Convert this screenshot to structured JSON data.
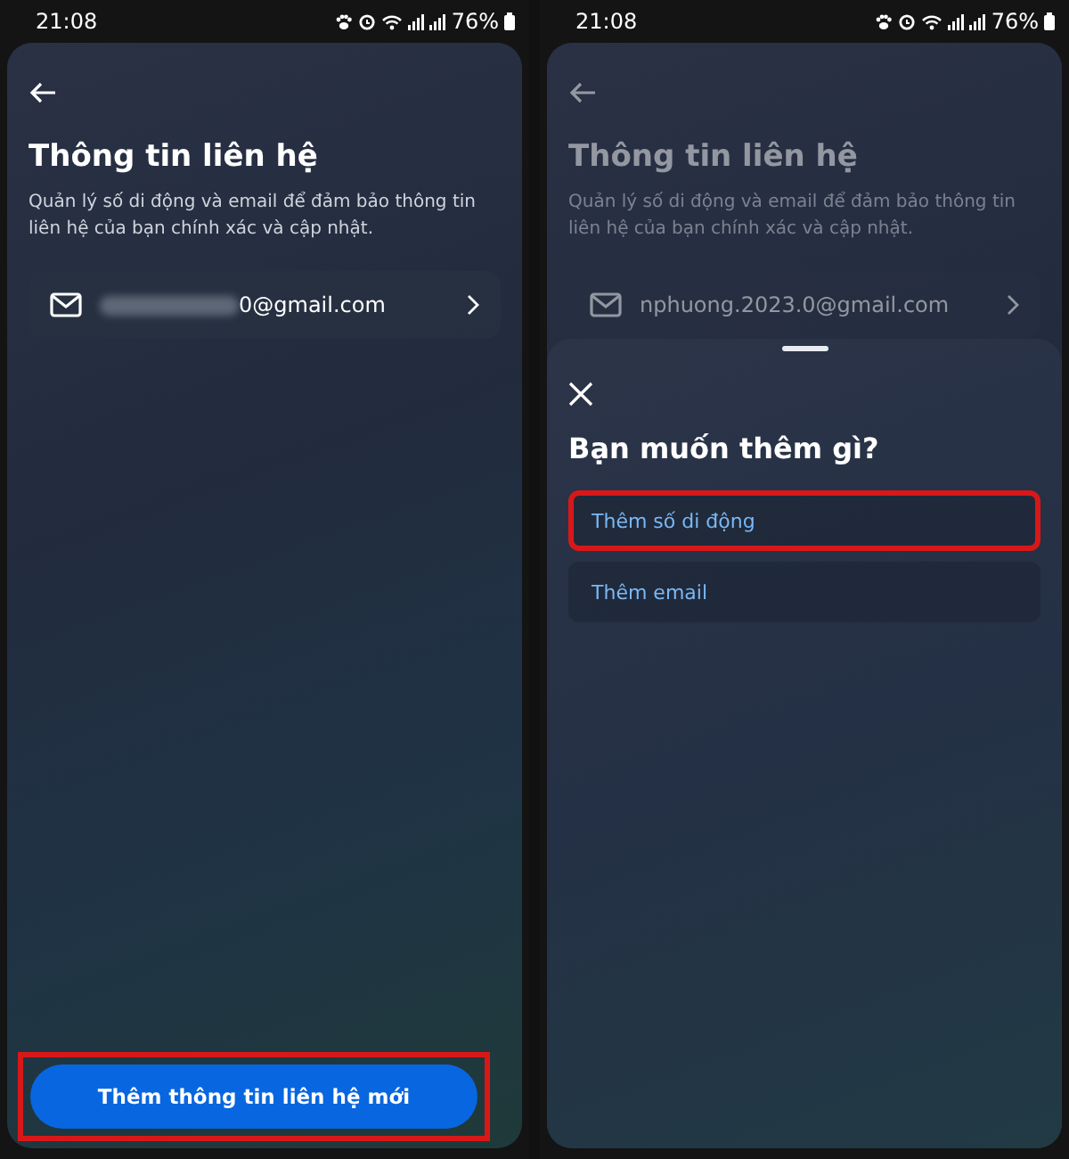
{
  "screens": [
    {
      "status_bar": {
        "time": "21:08",
        "battery": "76%"
      },
      "page": {
        "dimmed": false,
        "title": "Thông tin liên hệ",
        "description": "Quản lý số di động và email để đảm bảo thông tin liên hệ của bạn chính xác và cập nhật.",
        "contacts": [
          {
            "kind": "email",
            "value": "0@gmail.com",
            "redacted": true
          }
        ]
      },
      "add_button": {
        "label": "Thêm thông tin liên hệ mới",
        "highlighted": true
      }
    },
    {
      "status_bar": {
        "time": "21:08",
        "battery": "76%"
      },
      "page": {
        "dimmed": true,
        "title": "Thông tin liên hệ",
        "description": "Quản lý số di động và email để đảm bảo thông tin liên hệ của bạn chính xác và cập nhật.",
        "contacts": [
          {
            "kind": "email",
            "value": "nphuong.2023.0@gmail.com",
            "redacted": false
          }
        ]
      },
      "sheet": {
        "title": "Bạn muốn thêm gì?",
        "options": [
          {
            "label": "Thêm số di động",
            "highlighted": true
          },
          {
            "label": "Thêm email",
            "highlighted": false
          }
        ]
      }
    }
  ]
}
